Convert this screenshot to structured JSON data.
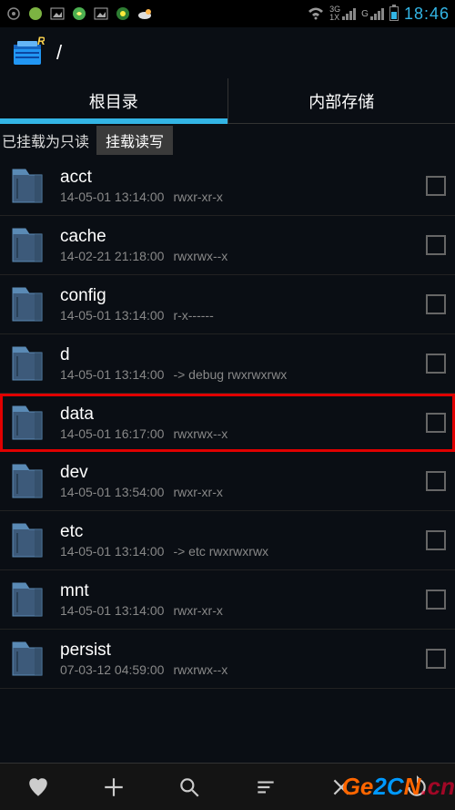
{
  "status": {
    "clock": "18:46",
    "net1_label": "3G",
    "net1_sub": "1X",
    "net2_label": "G"
  },
  "header": {
    "path": "/"
  },
  "tabs": {
    "root": "根目录",
    "internal": "内部存储"
  },
  "mount": {
    "status": "已挂载为只读",
    "button": "挂载读写"
  },
  "files": [
    {
      "name": "acct",
      "date": "14-05-01 13:14:00",
      "perm": "rwxr-xr-x",
      "highlighted": false
    },
    {
      "name": "cache",
      "date": "14-02-21 21:18:00",
      "perm": "rwxrwx--x",
      "highlighted": false
    },
    {
      "name": "config",
      "date": "14-05-01 13:14:00",
      "perm": "r-x------",
      "highlighted": false
    },
    {
      "name": "d",
      "date": "14-05-01 13:14:00",
      "perm": "-> debug  rwxrwxrwx",
      "highlighted": false
    },
    {
      "name": "data",
      "date": "14-05-01 16:17:00",
      "perm": "rwxrwx--x",
      "highlighted": true
    },
    {
      "name": "dev",
      "date": "14-05-01 13:54:00",
      "perm": "rwxr-xr-x",
      "highlighted": false
    },
    {
      "name": "etc",
      "date": "14-05-01 13:14:00",
      "perm": "-> etc  rwxrwxrwx",
      "highlighted": false
    },
    {
      "name": "mnt",
      "date": "14-05-01 13:14:00",
      "perm": "rwxr-xr-x",
      "highlighted": false
    },
    {
      "name": "persist",
      "date": "07-03-12 04:59:00",
      "perm": "rwxrwx--x",
      "highlighted": false
    }
  ]
}
